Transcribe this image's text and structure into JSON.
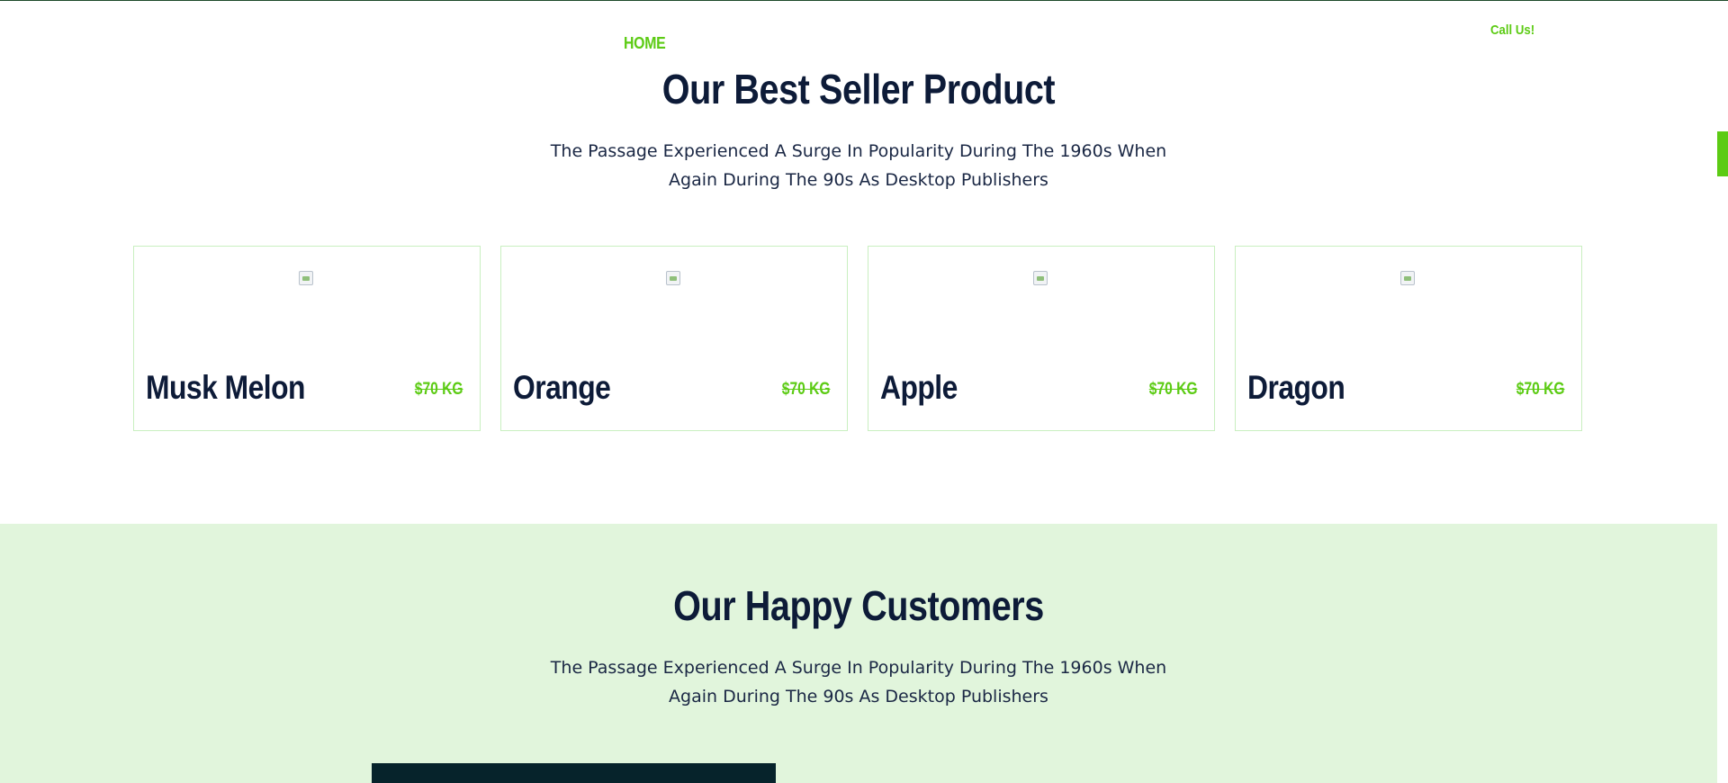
{
  "nav": {
    "home_label": "HOME",
    "call_label": "Call Us!"
  },
  "colors": {
    "accent": "#5ccb14",
    "heading": "#0d1b38",
    "customers_bg": "#e1f5dc",
    "card_border": "#c9efc0",
    "dark_block": "#06232b"
  },
  "best_seller": {
    "title": "Our Best Seller Product",
    "subtitle_line1": "The Passage Experienced A Surge In Popularity During The 1960s When",
    "subtitle_line2": "Again During The 90s As Desktop Publishers",
    "products": [
      {
        "name": "Musk Melon",
        "price": "$70 KG",
        "image_icon": "broken-image-icon"
      },
      {
        "name": "Orange",
        "price": "$70 KG",
        "image_icon": "broken-image-icon"
      },
      {
        "name": "Apple",
        "price": "$70 KG",
        "image_icon": "broken-image-icon"
      },
      {
        "name": "Dragon",
        "price": "$70 KG",
        "image_icon": "broken-image-icon"
      }
    ]
  },
  "customers": {
    "title": "Our Happy Customers",
    "subtitle_line1": "The Passage Experienced A Surge In Popularity During The 1960s When",
    "subtitle_line2": "Again During The 90s As Desktop Publishers"
  }
}
